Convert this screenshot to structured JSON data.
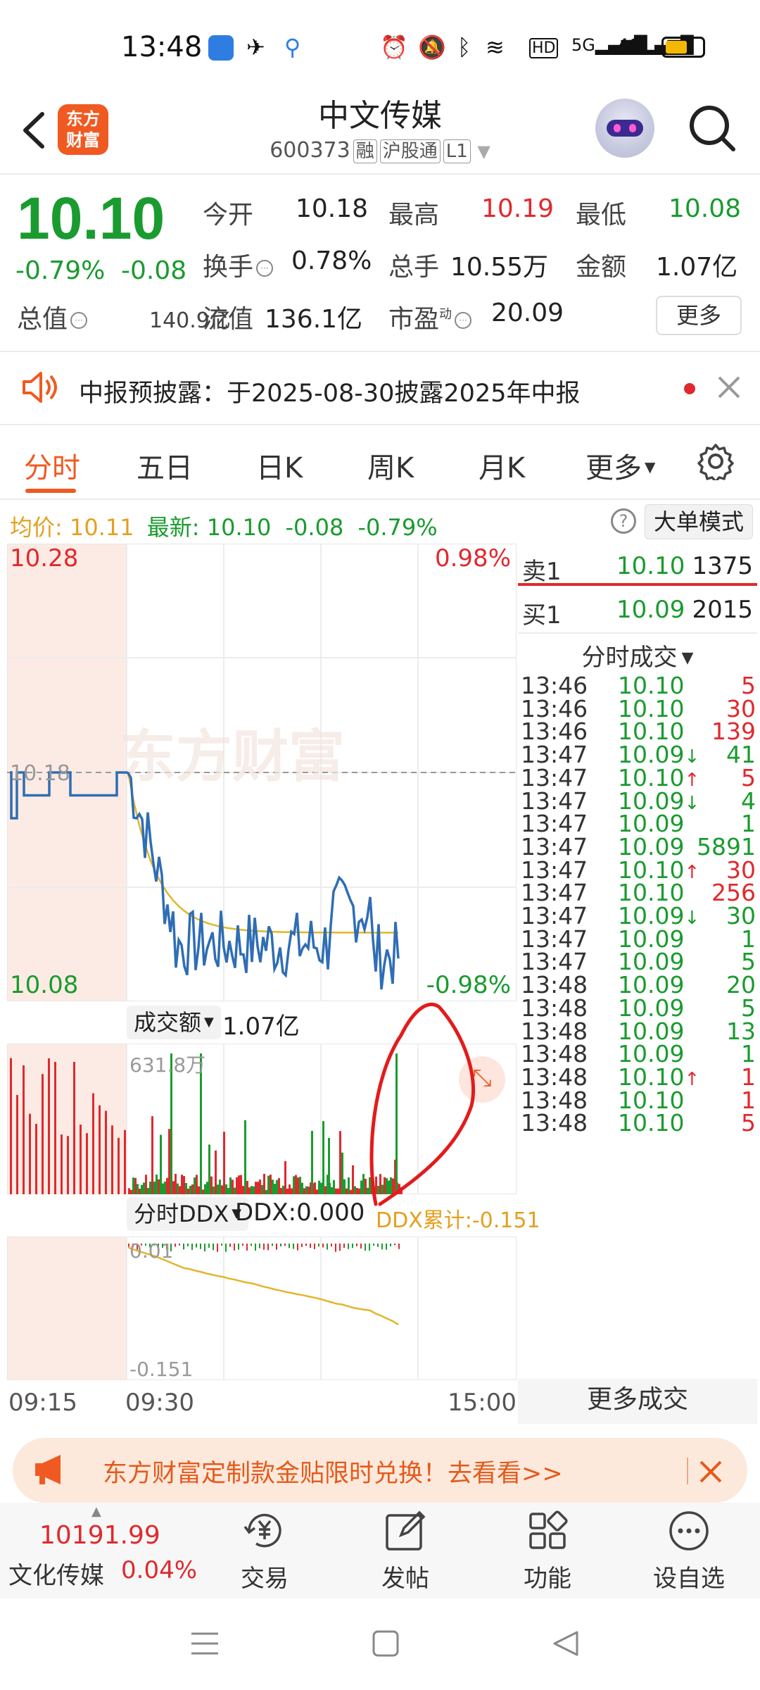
{
  "status_bar": {
    "time": "13:48"
  },
  "header": {
    "logo_text": "东方财富",
    "stock_name": "中文传媒",
    "stock_code": "600373",
    "tags": [
      "融",
      "沪股通",
      "L1"
    ]
  },
  "quote": {
    "price": "10.10",
    "change_pct": "-0.79%",
    "change": "-0.08",
    "open_label": "今开",
    "open": "10.18",
    "high_label": "最高",
    "high": "10.19",
    "low_label": "最低",
    "low": "10.08",
    "turnover_label": "换手",
    "turnover": "0.78%",
    "volume_label": "总手",
    "volume": "10.55万",
    "amount_label": "金额",
    "amount": "1.07亿",
    "total_mv_label": "总值",
    "total_mv": "140.9亿",
    "float_mv_label": "流值",
    "float_mv": "136.1亿",
    "pe_label": "市盈",
    "pe_sup": "动",
    "pe": "20.09",
    "more_label": "更多"
  },
  "announcement": {
    "text": "中报预披露：于2025-08-30披露2025年中报"
  },
  "tabs": [
    "分时",
    "五日",
    "日K",
    "周K",
    "月K",
    "更多"
  ],
  "price_line": {
    "avg_label": "均价:",
    "avg": "10.11",
    "latest_label": "最新:",
    "latest": "10.10",
    "latest_chg": "-0.08",
    "latest_pct": "-0.79%",
    "big_order_mode": "大单模式"
  },
  "order_book": {
    "sell1_label": "卖1",
    "sell1_price": "10.10",
    "sell1_vol": "1375",
    "buy1_label": "买1",
    "buy1_price": "10.09",
    "buy1_vol": "2015",
    "trades_header": "分时成交"
  },
  "trades": [
    {
      "time": "13:46",
      "price": "10.10",
      "arrow": "",
      "vol": "5",
      "dir": "up"
    },
    {
      "time": "13:46",
      "price": "10.10",
      "arrow": "",
      "vol": "30",
      "dir": "up"
    },
    {
      "time": "13:46",
      "price": "10.10",
      "arrow": "",
      "vol": "139",
      "dir": "up"
    },
    {
      "time": "13:47",
      "price": "10.09",
      "arrow": "↓",
      "vol": "41",
      "dir": "down"
    },
    {
      "time": "13:47",
      "price": "10.10",
      "arrow": "↑",
      "vol": "5",
      "dir": "up"
    },
    {
      "time": "13:47",
      "price": "10.09",
      "arrow": "↓",
      "vol": "4",
      "dir": "down"
    },
    {
      "time": "13:47",
      "price": "10.09",
      "arrow": "",
      "vol": "1",
      "dir": "down"
    },
    {
      "time": "13:47",
      "price": "10.09",
      "arrow": "",
      "vol": "5891",
      "dir": "down"
    },
    {
      "time": "13:47",
      "price": "10.10",
      "arrow": "↑",
      "vol": "30",
      "dir": "up"
    },
    {
      "time": "13:47",
      "price": "10.10",
      "arrow": "",
      "vol": "256",
      "dir": "up"
    },
    {
      "time": "13:47",
      "price": "10.09",
      "arrow": "↓",
      "vol": "30",
      "dir": "down"
    },
    {
      "time": "13:47",
      "price": "10.09",
      "arrow": "",
      "vol": "1",
      "dir": "down"
    },
    {
      "time": "13:47",
      "price": "10.09",
      "arrow": "",
      "vol": "5",
      "dir": "down"
    },
    {
      "time": "13:48",
      "price": "10.09",
      "arrow": "",
      "vol": "20",
      "dir": "down"
    },
    {
      "time": "13:48",
      "price": "10.09",
      "arrow": "",
      "vol": "5",
      "dir": "down"
    },
    {
      "time": "13:48",
      "price": "10.09",
      "arrow": "",
      "vol": "13",
      "dir": "down"
    },
    {
      "time": "13:48",
      "price": "10.09",
      "arrow": "",
      "vol": "1",
      "dir": "down"
    },
    {
      "time": "13:48",
      "price": "10.10",
      "arrow": "↑",
      "vol": "1",
      "dir": "up"
    },
    {
      "time": "13:48",
      "price": "10.10",
      "arrow": "",
      "vol": "1",
      "dir": "up"
    },
    {
      "time": "13:48",
      "price": "10.10",
      "arrow": "",
      "vol": "5",
      "dir": "up"
    }
  ],
  "more_trades_label": "更多成交",
  "chart": {
    "y_top": "10.28",
    "y_bottom": "10.08",
    "y_mid": "10.18",
    "pct_top": "0.98%",
    "pct_bottom": "-0.98%",
    "watermark": "东方财富",
    "vol_label": "成交额",
    "vol_value": "1.07亿",
    "vol_max": "631.8万",
    "ddx_label": "分时DDX",
    "ddx_value": "DDX:0.000",
    "ddx_cum": "DDX累计:-0.151",
    "ddx_top": "0.01",
    "ddx_bottom": "-0.151",
    "time_start": "09:15",
    "time_open": "09:30",
    "time_end": "15:00"
  },
  "promo": {
    "text": "东方财富定制款金贴限时兑换！去看看>>"
  },
  "bottom_bar": {
    "index_value": "10191.99",
    "index_name": "文化传媒",
    "index_pct": "0.04%",
    "items": [
      "交易",
      "发帖",
      "功能",
      "设自选"
    ]
  },
  "colors": {
    "up": "#e0292e",
    "down": "#1a9b2f",
    "brand": "#f05a22",
    "line": "#2f6db5",
    "avg": "#e3b52a"
  }
}
